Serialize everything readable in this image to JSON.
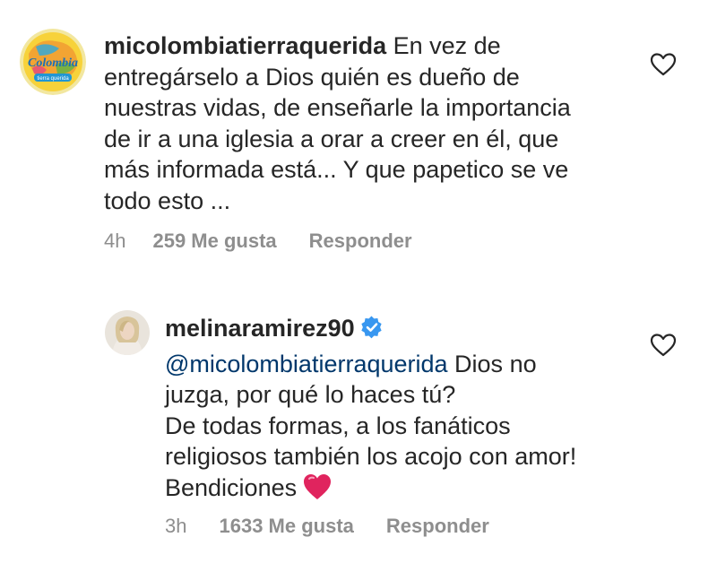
{
  "comments": [
    {
      "username": "micolombiatierraquerida",
      "avatar_text": "Colombia",
      "avatar_subtext": "tierra querida",
      "text": " En vez de entregárselo a Dios quién es dueño de nuestras vidas, de enseñarle la importancia de ir a una iglesia a orar a creer en él, que más informada está... Y que papetico se ve todo esto ...",
      "time": "4h",
      "likes": "259 Me gusta",
      "reply": "Responder"
    },
    {
      "username": "melinaramirez90",
      "verified": true,
      "mention": "@micolombiatierraquerida",
      "text": " Dios no juzga, por qué lo haces tú?",
      "text2": "De todas formas, a los fanáticos religiosos también los acojo con amor! Bendiciones",
      "emoji": "red-heart",
      "time": "3h",
      "likes": "1633 Me gusta",
      "reply": "Responder"
    }
  ],
  "icons": {
    "like": "heart-outline-icon",
    "verified": "verified-badge-icon"
  },
  "colors": {
    "text": "#262626",
    "meta": "#8e8e8e",
    "mention": "#00376b",
    "verified": "#3897f0",
    "emoji_heart": "#e0245e"
  }
}
